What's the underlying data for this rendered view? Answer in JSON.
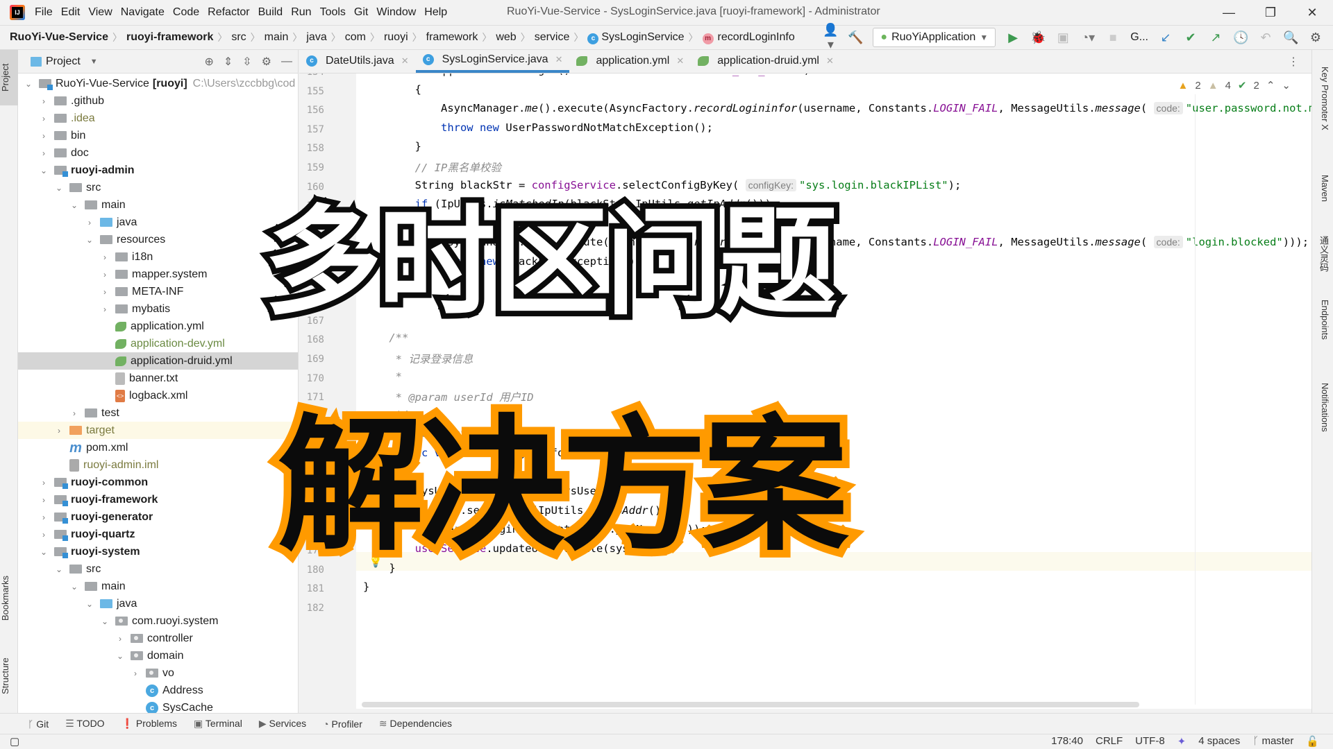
{
  "window": {
    "title": "RuoYi-Vue-Service - SysLoginService.java [ruoyi-framework] - Administrator",
    "controls": {
      "minimize": "—",
      "restore": "❐",
      "close": "✕"
    }
  },
  "menu": [
    "File",
    "Edit",
    "View",
    "Navigate",
    "Code",
    "Refactor",
    "Build",
    "Run",
    "Tools",
    "Git",
    "Window",
    "Help"
  ],
  "breadcrumb": [
    {
      "label": "RuoYi-Vue-Service",
      "bold": true
    },
    {
      "label": "ruoyi-framework",
      "bold": true
    },
    {
      "label": "src"
    },
    {
      "label": "main"
    },
    {
      "label": "java"
    },
    {
      "label": "com"
    },
    {
      "label": "ruoyi"
    },
    {
      "label": "framework"
    },
    {
      "label": "web"
    },
    {
      "label": "service"
    },
    {
      "label": "SysLoginService",
      "icon": "class-icon"
    },
    {
      "label": "recordLoginInfo",
      "icon": "method-icon"
    }
  ],
  "toolbar": {
    "run_config": "RuoYiApplication",
    "git_label": "G..."
  },
  "project_panel": {
    "title": "Project",
    "tree": [
      {
        "label": "RuoYi-Vue-Service",
        "suffix": "[ruoyi]",
        "path": "C:\\Users\\zccbbg\\cod",
        "depth": 0,
        "expanded": true,
        "type": "module"
      },
      {
        "label": ".github",
        "depth": 1,
        "expanded": false,
        "type": "folder"
      },
      {
        "label": ".idea",
        "depth": 1,
        "expanded": false,
        "type": "folder",
        "style": "olive"
      },
      {
        "label": "bin",
        "depth": 1,
        "expanded": false,
        "type": "folder"
      },
      {
        "label": "doc",
        "depth": 1,
        "expanded": false,
        "type": "folder"
      },
      {
        "label": "ruoyi-admin",
        "depth": 1,
        "expanded": true,
        "type": "module",
        "bold": true
      },
      {
        "label": "src",
        "depth": 2,
        "expanded": true,
        "type": "folder"
      },
      {
        "label": "main",
        "depth": 3,
        "expanded": true,
        "type": "folder"
      },
      {
        "label": "java",
        "depth": 4,
        "expanded": false,
        "type": "src-folder"
      },
      {
        "label": "resources",
        "depth": 4,
        "expanded": true,
        "type": "res-folder"
      },
      {
        "label": "i18n",
        "depth": 5,
        "expanded": false,
        "type": "folder"
      },
      {
        "label": "mapper.system",
        "depth": 5,
        "expanded": false,
        "type": "folder"
      },
      {
        "label": "META-INF",
        "depth": 5,
        "expanded": false,
        "type": "folder"
      },
      {
        "label": "mybatis",
        "depth": 5,
        "expanded": false,
        "type": "folder"
      },
      {
        "label": "application.yml",
        "depth": 5,
        "type": "yml"
      },
      {
        "label": "application-dev.yml",
        "depth": 5,
        "type": "yml",
        "style": "green"
      },
      {
        "label": "application-druid.yml",
        "depth": 5,
        "type": "yml",
        "selected": true
      },
      {
        "label": "banner.txt",
        "depth": 5,
        "type": "txt"
      },
      {
        "label": "logback.xml",
        "depth": 5,
        "type": "xml"
      },
      {
        "label": "test",
        "depth": 3,
        "expanded": false,
        "type": "folder"
      },
      {
        "label": "target",
        "depth": 2,
        "expanded": false,
        "type": "excluded",
        "style": "olive",
        "highlight": true
      },
      {
        "label": "pom.xml",
        "depth": 2,
        "type": "maven"
      },
      {
        "label": "ruoyi-admin.iml",
        "depth": 2,
        "type": "iml",
        "style": "olive"
      },
      {
        "label": "ruoyi-common",
        "depth": 1,
        "expanded": false,
        "type": "module",
        "bold": true
      },
      {
        "label": "ruoyi-framework",
        "depth": 1,
        "expanded": false,
        "type": "module",
        "bold": true
      },
      {
        "label": "ruoyi-generator",
        "depth": 1,
        "expanded": false,
        "type": "module",
        "bold": true
      },
      {
        "label": "ruoyi-quartz",
        "depth": 1,
        "expanded": false,
        "type": "module",
        "bold": true
      },
      {
        "label": "ruoyi-system",
        "depth": 1,
        "expanded": true,
        "type": "module",
        "bold": true
      },
      {
        "label": "src",
        "depth": 2,
        "expanded": true,
        "type": "folder"
      },
      {
        "label": "main",
        "depth": 3,
        "expanded": true,
        "type": "folder"
      },
      {
        "label": "java",
        "depth": 4,
        "expanded": true,
        "type": "src-folder"
      },
      {
        "label": "com.ruoyi.system",
        "depth": 5,
        "expanded": true,
        "type": "package"
      },
      {
        "label": "controller",
        "depth": 6,
        "expanded": false,
        "type": "package"
      },
      {
        "label": "domain",
        "depth": 6,
        "expanded": true,
        "type": "package"
      },
      {
        "label": "vo",
        "depth": 7,
        "expanded": false,
        "type": "package"
      },
      {
        "label": "Address",
        "depth": 7,
        "type": "class"
      },
      {
        "label": "SysCache",
        "depth": 7,
        "type": "class"
      }
    ]
  },
  "editor_tabs": [
    {
      "label": "DateUtils.java",
      "icon": "class-icon",
      "active": false
    },
    {
      "label": "SysLoginService.java",
      "icon": "class-icon",
      "active": true
    },
    {
      "label": "application.yml",
      "icon": "yml-icon",
      "active": false
    },
    {
      "label": "application-druid.yml",
      "icon": "yml-icon",
      "active": false
    }
  ],
  "inspections": {
    "warnings": "2",
    "weak_warnings": "4",
    "typos": "2"
  },
  "code_lines": [
    {
      "n": "154",
      "html": "            || username.length() > UserConstants.<span class='pur it'>USERNAME_MAX_LENGTH</span>)"
    },
    {
      "n": "155",
      "html": "        {"
    },
    {
      "n": "156",
      "html": "            AsyncManager.<span class='it'>me</span>().execute(AsyncFactory.<span class='it'>recordLogininfor</span>(username, Constants.<span class='pur it'>LOGIN_FAIL</span>, MessageUtils.<span class='it'>message</span>( <span class='hint'>code:</span><span class='str'>\"user.password.not.match\"</span>)));"
    },
    {
      "n": "157",
      "html": "            <span class='kw'>throw new</span> UserPasswordNotMatchException();"
    },
    {
      "n": "158",
      "html": "        }"
    },
    {
      "n": "159",
      "html": "        <span class='cmt'>// IP黑名单校验</span>"
    },
    {
      "n": "160",
      "html": "        String blackStr = <span class='pur'>configService</span>.selectConfigByKey( <span class='hint'>configKey:</span><span class='str'>\"sys.login.blackIPList\"</span>);"
    },
    {
      "n": "161",
      "html": "        <span class='kw'>if</span> (IpUtils.<span class='it'>isMatchedIp</span>(blackStr, IpUtils.<span class='it'>getIpAddr</span>()))"
    },
    {
      "n": "162",
      "html": "        {"
    },
    {
      "n": "163",
      "html": "            AsyncManager.<span class='it'>me</span>().execute(AsyncFactory.<span class='it'>recordLogininfor</span>(username, Constants.<span class='pur it'>LOGIN_FAIL</span>, MessageUtils.<span class='it'>message</span>( <span class='hint'>code:</span><span class='str'>\"login.blocked\"</span>)));"
    },
    {
      "n": "164",
      "html": "            <span class='kw'>throw new</span> BlackListException();"
    },
    {
      "n": "165",
      "html": "        }"
    },
    {
      "n": "166",
      "html": "    }"
    },
    {
      "n": "167",
      "html": ""
    },
    {
      "n": "168",
      "html": "    <span class='cmt'>/**</span>"
    },
    {
      "n": "169",
      "html": "     <span class='cmt'>* 记录登录信息</span>"
    },
    {
      "n": "170",
      "html": "     <span class='cmt'>*</span>"
    },
    {
      "n": "171",
      "html": "     <span class='cmt'>* @param userId 用户ID</span>"
    },
    {
      "n": "172",
      "html": "     <span class='cmt'>*/</span>"
    },
    {
      "n": "173",
      "html": "    <span class='cmt'>@author lihy</span>"
    },
    {
      "n": "174",
      "html": "    <span class='kw'>public void</span> recordLoginInfo(Long userId)"
    },
    {
      "n": "175",
      "html": "    {"
    },
    {
      "n": "176",
      "html": "        SysUser sysUser = <span class='kw'>new</span> SysUser();"
    },
    {
      "n": "177",
      "html": "        sysUser.setLoginIp(IpUtils.<span class='it'>getIpAddr</span>());"
    },
    {
      "n": "178",
      "html": "        sysUser.setLoginDate(DateUtils.<span class='it'>getNowDate</span>());"
    },
    {
      "n": "179",
      "html": "        <span class='pur'>userService</span>.updateUserProfile(sysUser);"
    },
    {
      "n": "180",
      "html": "    }"
    },
    {
      "n": "181",
      "html": "}"
    },
    {
      "n": "182",
      "html": ""
    }
  ],
  "right_tool_windows": [
    "Key Promoter X",
    "Maven",
    "通义灵码",
    "Endpoints",
    "Notifications"
  ],
  "left_tool_windows": [
    "Project",
    "Bookmarks",
    "Structure"
  ],
  "bottom_tools": [
    {
      "label": "Git",
      "icon": "git-branch-icon"
    },
    {
      "label": "TODO",
      "icon": "list-icon"
    },
    {
      "label": "Problems",
      "icon": "alert-icon"
    },
    {
      "label": "Terminal",
      "icon": "terminal-icon"
    },
    {
      "label": "Services",
      "icon": "play-circle-icon"
    },
    {
      "label": "Profiler",
      "icon": "profiler-icon"
    },
    {
      "label": "Dependencies",
      "icon": "layers-icon"
    }
  ],
  "status_bar": {
    "position": "178:40",
    "line_separator": "CRLF",
    "encoding": "UTF-8",
    "indent": "4 spaces",
    "branch": "master"
  },
  "overlay": {
    "line1": "多时区问题",
    "line2": "解决方案",
    "colors": {
      "line1_fill": "#ffffff",
      "line1_stroke": "#0b0b0b",
      "line2_fill": "#0b0b0b",
      "line2_stroke": "#ff9a00"
    }
  }
}
